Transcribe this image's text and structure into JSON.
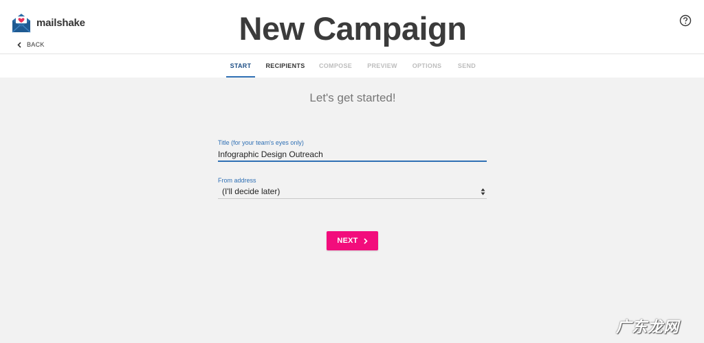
{
  "brand": {
    "name": "mailshake",
    "logo_icon": "mailshake-envelope-icon",
    "accent_color": "#e8325a"
  },
  "header": {
    "back_label": "BACK",
    "page_title": "New Campaign",
    "help_icon": "question-circle-icon"
  },
  "tabs": [
    {
      "label": "START",
      "state": "active"
    },
    {
      "label": "RECIPIENTS",
      "state": "enabled"
    },
    {
      "label": "COMPOSE",
      "state": "disabled"
    },
    {
      "label": "PREVIEW",
      "state": "disabled"
    },
    {
      "label": "OPTIONS",
      "state": "disabled"
    },
    {
      "label": "SEND",
      "state": "disabled"
    }
  ],
  "form": {
    "subtitle": "Let's get started!",
    "title_label": "Title (for your team's eyes only)",
    "title_value": "Infographic Design Outreach",
    "from_label": "From address",
    "from_value": "(I'll decide later)"
  },
  "next_button": {
    "label": "NEXT",
    "color": "#f20d7c"
  },
  "watermark": "广东龙网",
  "colors": {
    "accent_blue": "#2e6fb4",
    "background": "#f2f2f2"
  }
}
